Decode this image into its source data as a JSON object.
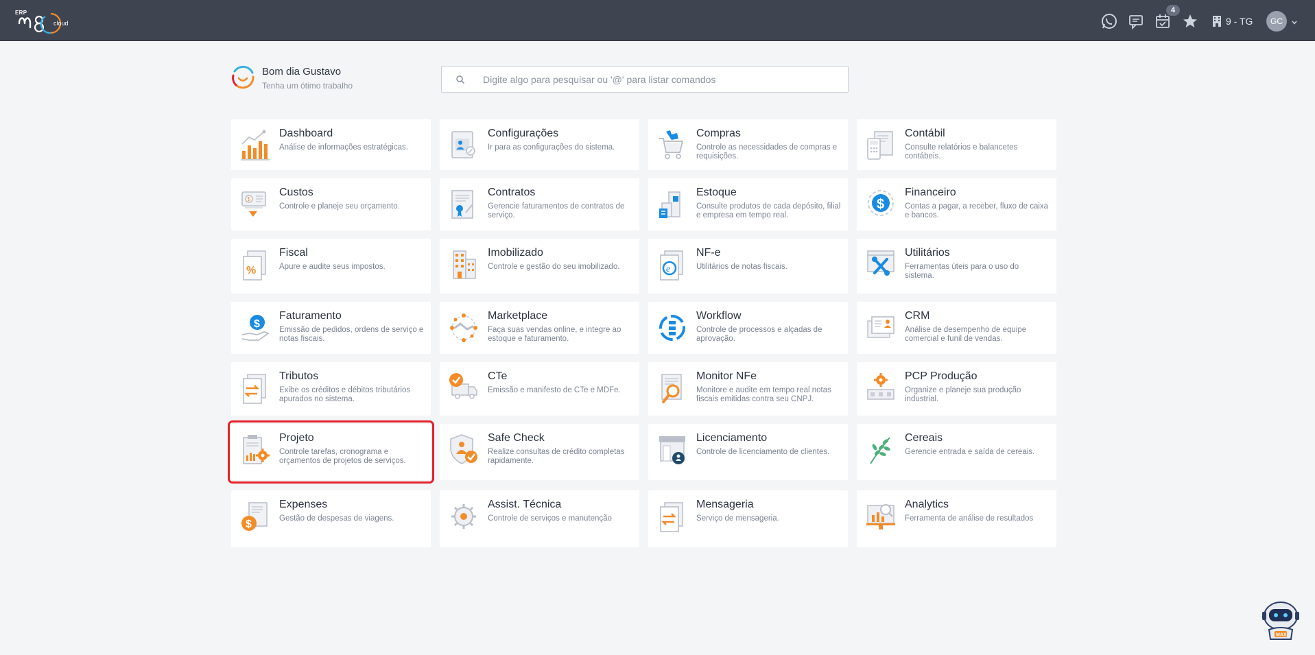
{
  "topbar": {
    "logo": {
      "erp_label": "ERP",
      "brand": "m8",
      "brand_suffix": "cloud"
    },
    "icons": [
      "whatsapp-icon",
      "chat-icon",
      "calendar-check-icon",
      "star-icon",
      "building-icon"
    ],
    "notifications_count": "4",
    "company_label": "9 - TG",
    "avatar_initials": "GC"
  },
  "greeting": {
    "title": "Bom dia Gustavo",
    "subtitle": "Tenha um ótimo trabalho"
  },
  "search": {
    "placeholder": "Digite algo para pesquisar ou '@' para listar comandos",
    "value": ""
  },
  "modules": [
    {
      "title": "Dashboard",
      "desc": "Análise de informações estratégicas.",
      "icon": "dashboard-chart-icon"
    },
    {
      "title": "Configurações",
      "desc": "Ir para as configurações do sistema.",
      "icon": "settings-profile-icon"
    },
    {
      "title": "Compras",
      "desc": "Controle as necessidades de compras e requisições.",
      "icon": "shopping-cart-icon"
    },
    {
      "title": "Contábil",
      "desc": "Consulte relatórios e balancetes contábeis.",
      "icon": "calculator-report-icon"
    },
    {
      "title": "Custos",
      "desc": "Controle e planeje seu orçamento.",
      "icon": "money-cost-icon"
    },
    {
      "title": "Contratos",
      "desc": "Gerencie faturamentos de contratos de serviço.",
      "icon": "contract-icon"
    },
    {
      "title": "Estoque",
      "desc": "Consulte produtos de cada depósito, filial e empresa em tempo real.",
      "icon": "warehouse-icon"
    },
    {
      "title": "Financeiro",
      "desc": "Contas a pagar, a receber, fluxo de caixa e bancos.",
      "icon": "dollar-coin-icon"
    },
    {
      "title": "Fiscal",
      "desc": "Apure e audite seus impostos.",
      "icon": "percent-document-icon"
    },
    {
      "title": "Imobilizado",
      "desc": "Controle e gestão do seu imobilizado.",
      "icon": "building-asset-icon"
    },
    {
      "title": "NF-e",
      "desc": "Utilitários de notas fiscais.",
      "icon": "nfe-document-icon"
    },
    {
      "title": "Utilitários",
      "desc": "Ferramentas úteis para o uso do sistema.",
      "icon": "tools-icon"
    },
    {
      "title": "Faturamento",
      "desc": "Emissão de pedidos, ordens de serviço e notas fiscais.",
      "icon": "billing-hand-icon"
    },
    {
      "title": "Marketplace",
      "desc": "Faça suas vendas online, e integre ao estoque e faturamento.",
      "icon": "handshake-network-icon"
    },
    {
      "title": "Workflow",
      "desc": "Controle de processos e alçadas de aprovação.",
      "icon": "workflow-icon"
    },
    {
      "title": "CRM",
      "desc": "Análise de desempenho de equipe comercial e funil de vendas.",
      "icon": "crm-card-icon"
    },
    {
      "title": "Tributos",
      "desc": "Exibe os créditos e débitos tributários apurados no sistema.",
      "icon": "tax-exchange-icon"
    },
    {
      "title": "CTe",
      "desc": "Emissão e manifesto de CTe e MDFe.",
      "icon": "truck-check-icon"
    },
    {
      "title": "Monitor NFe",
      "desc": "Monitore e audite em tempo real notas fiscais emitidas contra seu CNPJ.",
      "icon": "magnifier-document-icon"
    },
    {
      "title": "PCP Produção",
      "desc": "Organize e planeje sua produção industrial.",
      "icon": "production-gear-icon"
    },
    {
      "title": "Projeto",
      "desc": "Controle tarefas, cronograma e orçamentos de projetos de serviços.",
      "icon": "project-clipboard-icon"
    },
    {
      "title": "Safe Check",
      "desc": "Realize consultas de crédito completas rapidamente.",
      "icon": "shield-check-icon"
    },
    {
      "title": "Licenciamento",
      "desc": "Controle de licenciamento de clientes.",
      "icon": "license-store-icon"
    },
    {
      "title": "Cereais",
      "desc": "Gerencie entrada e saída de cereais.",
      "icon": "grain-leaf-icon"
    },
    {
      "title": "Expenses",
      "desc": "Gestão de despesas de viagens.",
      "icon": "expense-coin-icon"
    },
    {
      "title": "Assist. Técnica",
      "desc": "Controle de serviços e manutenção",
      "icon": "tech-gear-icon"
    },
    {
      "title": "Mensageria",
      "desc": "Serviço de mensageria.",
      "icon": "messaging-exchange-icon"
    },
    {
      "title": "Analytics",
      "desc": "Ferramenta de análise de resultados",
      "icon": "analytics-magnifier-icon"
    }
  ],
  "selected_module": "Projeto",
  "assistant": {
    "label": "MAX"
  },
  "colors": {
    "topbar": "#3f4451",
    "accent_orange": "#f28c28",
    "accent_blue": "#1a8be3",
    "selection": "#e4232b"
  }
}
